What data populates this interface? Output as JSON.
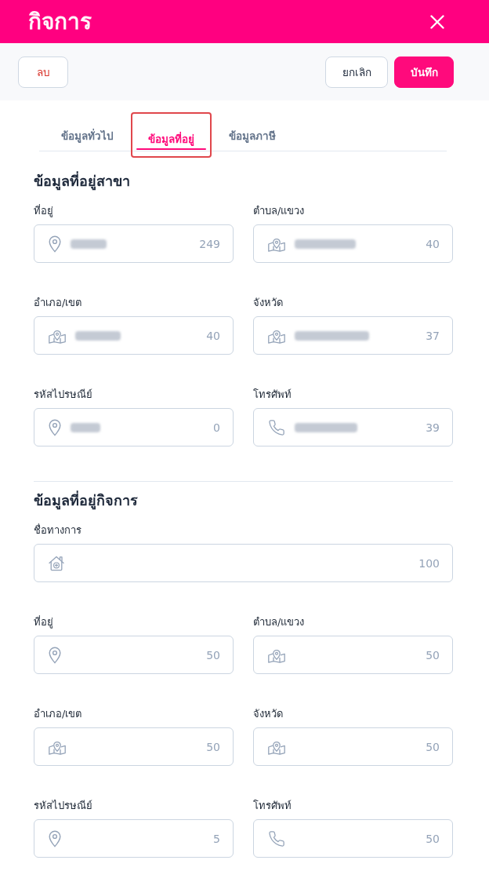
{
  "header": {
    "title": "กิจการ"
  },
  "toolbar": {
    "buttons": [
      {
        "label": "ลบ",
        "kind": "delete"
      },
      {
        "label": "ยกเลิก",
        "kind": "cancel"
      },
      {
        "label": "บันทึก",
        "kind": "save"
      }
    ]
  },
  "tabs": [
    {
      "label": "ข้อมูลทั่วไป",
      "selected": false
    },
    {
      "label": "ข้อมูลที่อยู่",
      "selected": true
    },
    {
      "label": "ข้อมูลภาษี",
      "selected": false
    }
  ],
  "sections": [
    {
      "title": "ข้อมูลที่อยู่สาขา",
      "rows": [
        [
          {
            "label": "ที่อยู่",
            "kind": "address",
            "redacted": true,
            "counter": "249"
          },
          {
            "label": "ตำบล/แขวง",
            "kind": "region",
            "redacted": true,
            "counter": "40"
          }
        ],
        [
          {
            "label": "อำเภอ/เขต",
            "kind": "region",
            "redacted": true,
            "counter": "40"
          },
          {
            "label": "จังหวัด",
            "kind": "region",
            "redacted": true,
            "counter": "37"
          }
        ],
        [
          {
            "label": "รหัสไปรษณีย์",
            "kind": "address",
            "redacted": true,
            "counter": "0"
          },
          {
            "label": "โทรศัพท์",
            "kind": "phone",
            "redacted": true,
            "counter": "39"
          }
        ]
      ]
    },
    {
      "title": "ข้อมูลที่อยู่กิจการ",
      "rows": [
        [
          {
            "label": "ชื่อทางการ",
            "kind": "business",
            "redacted": false,
            "counter": "100"
          }
        ],
        [
          {
            "label": "ที่อยู่",
            "kind": "address",
            "redacted": false,
            "counter": "50"
          },
          {
            "label": "ตำบล/แขวง",
            "kind": "region",
            "redacted": false,
            "counter": "50"
          }
        ],
        [
          {
            "label": "อำเภอ/เขต",
            "kind": "region",
            "redacted": false,
            "counter": "50"
          },
          {
            "label": "จังหวัด",
            "kind": "region",
            "redacted": false,
            "counter": "50"
          }
        ],
        [
          {
            "label": "รหัสไปรษณีย์",
            "kind": "address",
            "redacted": false,
            "counter": "5"
          },
          {
            "label": "โทรศัพท์",
            "kind": "phone",
            "redacted": false,
            "counter": "50"
          }
        ]
      ]
    }
  ]
}
